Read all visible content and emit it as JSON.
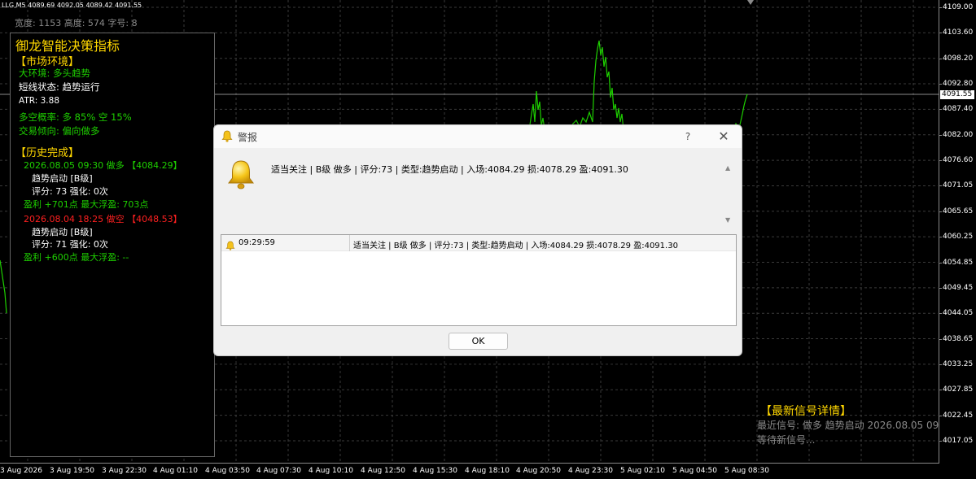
{
  "chart": {
    "symbol_line": "LLG,M5  4089.69 4092.05 4089.42 4091.55",
    "dims_line": "宽度: 1153  高度: 574  字号: 8",
    "current_price": "4091.55",
    "price_labels": [
      "4109.00",
      "4103.60",
      "4098.20",
      "4092.80",
      "4087.40",
      "4082.00",
      "4076.60",
      "4071.05",
      "4065.65",
      "4060.25",
      "4054.85",
      "4049.45",
      "4044.05",
      "4038.65",
      "4033.25",
      "4027.85",
      "4022.45",
      "4017.05"
    ],
    "time_labels": [
      "3 Aug 2026",
      "3 Aug 19:50",
      "3 Aug 22:30",
      "4 Aug 01:10",
      "4 Aug 03:50",
      "4 Aug 07:30",
      "4 Aug 10:10",
      "4 Aug 12:50",
      "4 Aug 15:30",
      "4 Aug 18:10",
      "4 Aug 20:50",
      "4 Aug 23:30",
      "5 Aug 02:10",
      "5 Aug 04:50",
      "5 Aug 08:30"
    ],
    "line_color": "#1ed000"
  },
  "panel": {
    "title": "御龙智能决策指标",
    "market_header": "【市场环境】",
    "big_env": "大环境: 多头趋势",
    "short_state": "短线状态: 趋势运行",
    "atr": "ATR: 3.88",
    "prob": "多空概率: 多 85%  空 15%",
    "tendency": "交易倾向: 偏向做多",
    "history_header": "【历史完成】",
    "h1_line": "2026.08.05 09:30 做多 【4084.29】",
    "h1_type": "趋势启动 [B级]",
    "h1_score": "评分: 73  强化: 0次",
    "h1_profit": "盈利 +701点  最大浮盈: 703点",
    "h2_line": "2026.08.04 18:25 做空 【4048.53】",
    "h2_type": "趋势启动 [B级]",
    "h2_score": "评分: 71  强化: 0次",
    "h2_profit": "盈利 +600点  最大浮盈: --"
  },
  "signal": {
    "title": "【最新信号详情】",
    "line1": "最近信号: 做多 趋势启动 2026.08.05 09:",
    "line2": "等待新信号..."
  },
  "dialog": {
    "title": "警报",
    "help": "?",
    "close": "✕",
    "message": "适当关注 | B级 做多 | 评分:73 | 类型:趋势启动 | 入场:4084.29 损:4078.29 盈:4091.30",
    "rows": [
      {
        "time": "09:29:59",
        "message": "适当关注 | B级 做多 | 评分:73 | 类型:趋势启动 | 入场:4084.29 损:4078.29 盈:4091.30"
      }
    ],
    "ok": "OK"
  }
}
